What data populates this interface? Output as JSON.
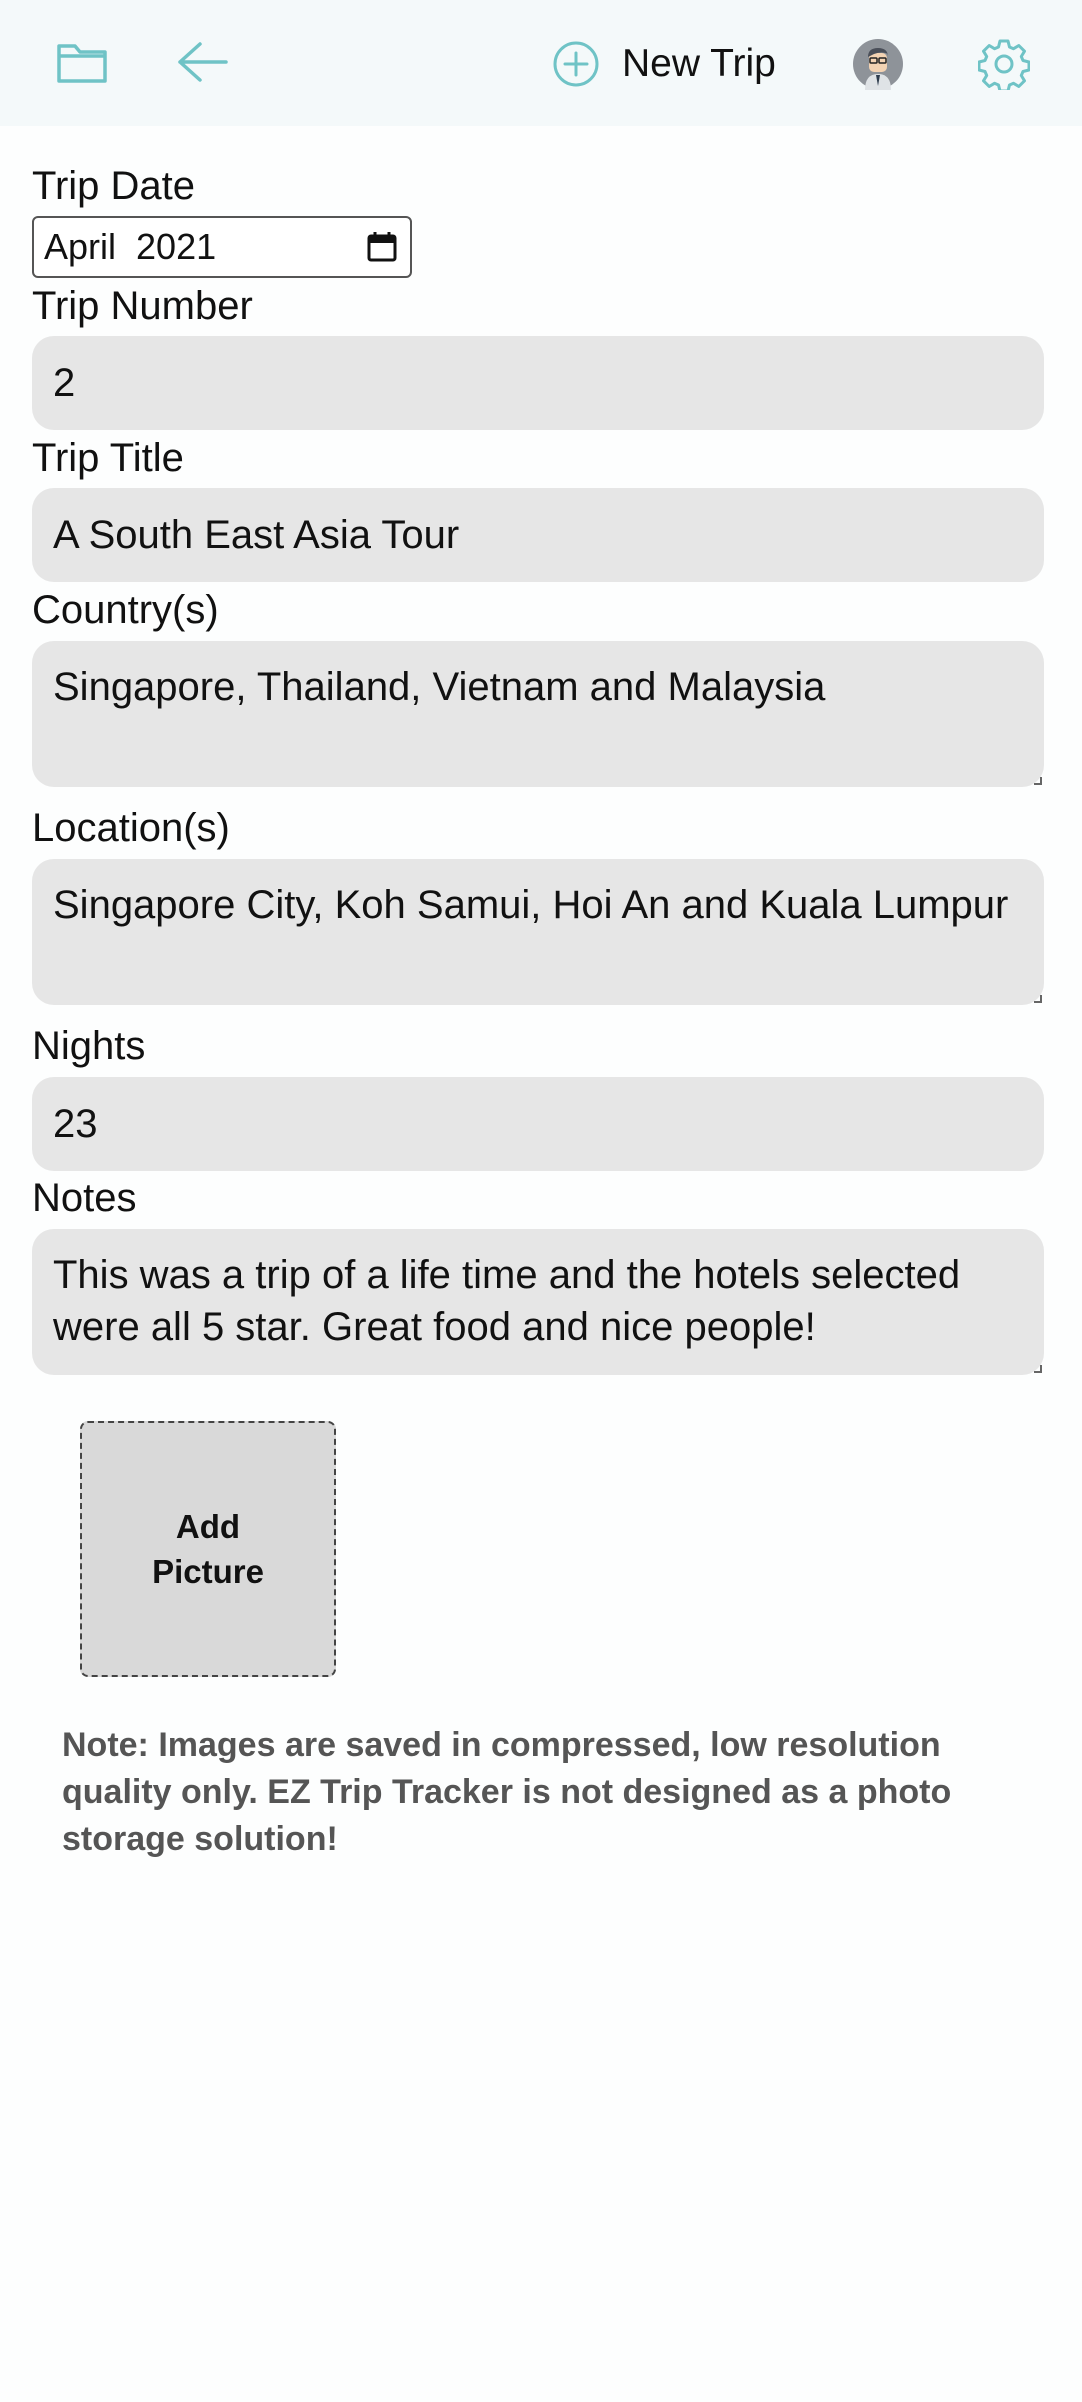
{
  "toolbar": {
    "folder_icon": "folder-icon",
    "back_icon": "arrow-left-icon",
    "new_trip_icon": "plus-circle-icon",
    "new_trip_label": "New Trip",
    "avatar_icon": "avatar-icon",
    "settings_icon": "gear-icon",
    "accent_color": "#6fc3c6"
  },
  "form": {
    "trip_date": {
      "label": "Trip Date",
      "value": "April  2021"
    },
    "trip_number": {
      "label": "Trip Number",
      "value": "2"
    },
    "trip_title": {
      "label": "Trip Title",
      "value": "A South East Asia Tour"
    },
    "countries": {
      "label": "Country(s)",
      "value": "Singapore, Thailand, Vietnam and Malaysia"
    },
    "locations": {
      "label": "Location(s)",
      "value": "Singapore City, Koh Samui, Hoi An and Kuala Lumpur"
    },
    "nights": {
      "label": "Nights",
      "value": "23"
    },
    "notes": {
      "label": "Notes",
      "value": "This was a trip of a life time and the hotels selected were all 5 star.  Great food and nice people!"
    }
  },
  "add_picture_label": "Add Picture",
  "image_note": "Note: Images are saved in compressed, low resolution quality only. EZ Trip Tracker is not designed as a photo storage solution!"
}
